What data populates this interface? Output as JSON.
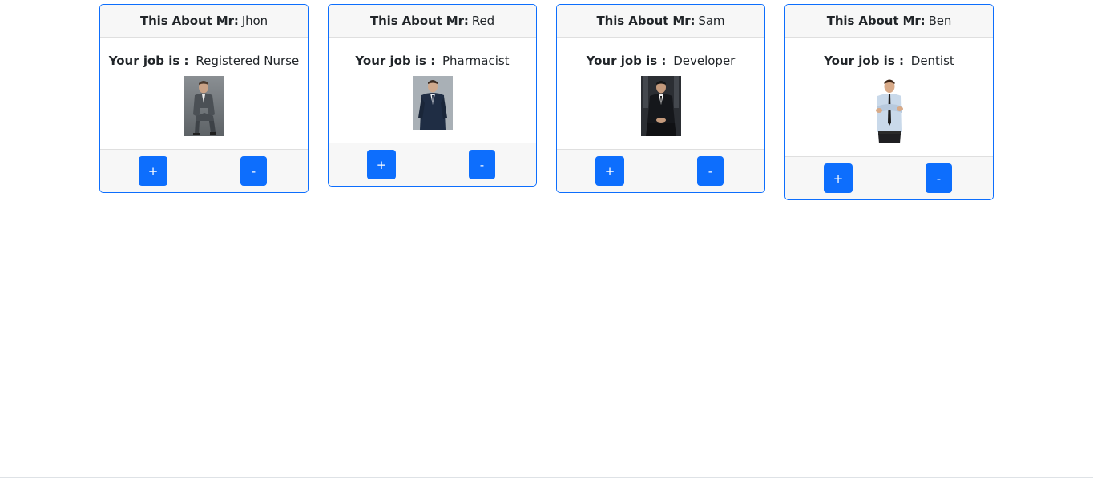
{
  "cards": [
    {
      "header_prefix": "This About Mr:",
      "name": "Jhon",
      "job_prefix": "Your job is :",
      "job": "Registered Nurse",
      "photo": "man-in-grey-suit-seated-photo",
      "plus_label": "+",
      "minus_label": "-"
    },
    {
      "header_prefix": "This About Mr:",
      "name": "Red",
      "job_prefix": "Your job is :",
      "job": "Pharmacist",
      "photo": "man-in-navy-suit-standing-photo",
      "plus_label": "+",
      "minus_label": "-"
    },
    {
      "header_prefix": "This About Mr:",
      "name": "Sam",
      "job_prefix": "Your job is :",
      "job": "Developer",
      "photo": "man-in-dark-suit-seated-photo",
      "plus_label": "+",
      "minus_label": "-"
    },
    {
      "header_prefix": "This About Mr:",
      "name": "Ben",
      "job_prefix": "Your job is :",
      "job": "Dentist",
      "photo": "man-with-crossed-arms-photo",
      "plus_label": "+",
      "minus_label": "-"
    }
  ],
  "colors": {
    "accent": "#0d6efd",
    "card_header_bg": "#f7f7f7",
    "text": "#212529"
  }
}
